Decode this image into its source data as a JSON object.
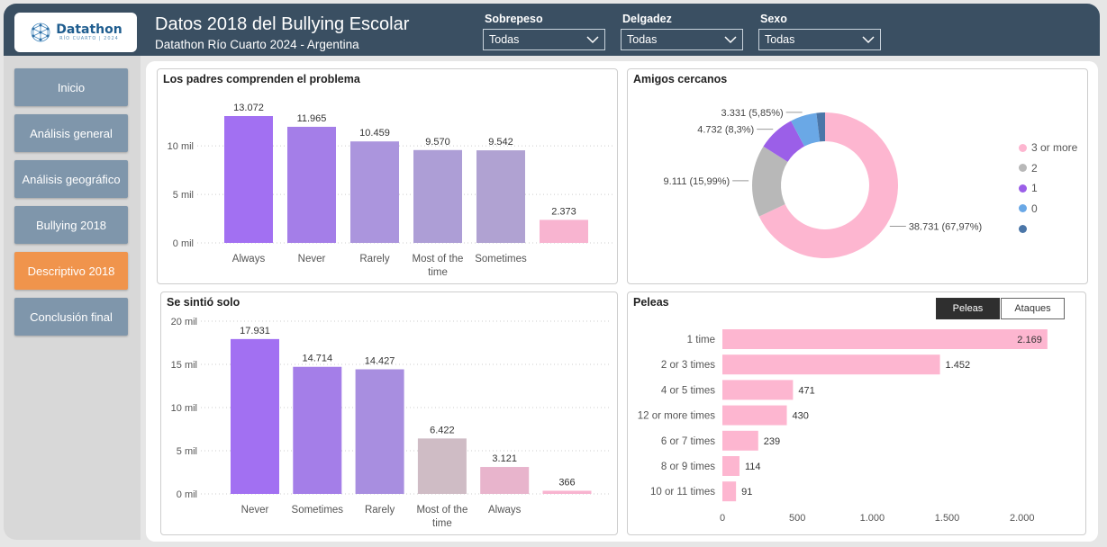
{
  "header": {
    "logo": {
      "brand": "Datathon",
      "sub": "RÍO CUARTO | 2024"
    },
    "title": "Datos 2018 del Bullying Escolar",
    "subtitle": "Datathon Río Cuarto 2024 - Argentina",
    "filters": [
      {
        "label": "Sobrepeso",
        "value": "Todas"
      },
      {
        "label": "Delgadez",
        "value": "Todas"
      },
      {
        "label": "Sexo",
        "value": "Todas"
      }
    ]
  },
  "sidebar": {
    "items": [
      {
        "label": "Inicio",
        "active": false
      },
      {
        "label": "Análisis general",
        "active": false
      },
      {
        "label": "Análisis geográfico",
        "active": false
      },
      {
        "label": "Bullying 2018",
        "active": false
      },
      {
        "label": "Descriptivo 2018",
        "active": true
      },
      {
        "label": "Conclusión final",
        "active": false
      }
    ],
    "active_color": "#f0944c",
    "default_color": "#7f96ab"
  },
  "chart_data": [
    {
      "id": "padres",
      "type": "bar",
      "title": "Los padres comprenden el problema",
      "categories": [
        "Always",
        "Never",
        "Rarely",
        "Most of the time",
        "Sometimes",
        ""
      ],
      "values": [
        13072,
        11965,
        10459,
        9570,
        9542,
        2373
      ],
      "value_labels": [
        "13.072",
        "11.965",
        "10.459",
        "9.570",
        "9.542",
        "2.373"
      ],
      "colors": [
        "#a270f2",
        "#a47ee8",
        "#ab95dd",
        "#ad9ed6",
        "#b0a2d2",
        "#f8b4d0"
      ],
      "yticks": [
        0,
        5000,
        10000
      ],
      "ytick_labels": [
        "0 mil",
        "5 mil",
        "10 mil"
      ],
      "ylim": [
        0,
        14000
      ],
      "grid": true
    },
    {
      "id": "amigos",
      "type": "pie",
      "title": "Amigos cercanos",
      "slices": [
        {
          "label": "3 or more",
          "value": 38731,
          "text": "38.731 (67,97%)",
          "color": "#fdb6d0"
        },
        {
          "label": "2",
          "value": 9111,
          "text": "9.111 (15,99%)",
          "color": "#b8b8b8"
        },
        {
          "label": "1",
          "value": 4732,
          "text": "4.732 (8,3%)",
          "color": "#9b5fe8"
        },
        {
          "label": "0",
          "value": 3331,
          "text": "3.331 (5,85%)",
          "color": "#6aa8e6"
        },
        {
          "label": "",
          "value": 1080,
          "text": "",
          "color": "#4b76a8"
        }
      ],
      "legend_position": "right"
    },
    {
      "id": "solo",
      "type": "bar",
      "title": "Se sintió solo",
      "categories": [
        "Never",
        "Sometimes",
        "Rarely",
        "Most of the time",
        "Always",
        ""
      ],
      "values": [
        17931,
        14714,
        14427,
        6422,
        3121,
        366
      ],
      "value_labels": [
        "17.931",
        "14.714",
        "14.427",
        "6.422",
        "3.121",
        "366"
      ],
      "colors": [
        "#a270f2",
        "#a47ee8",
        "#a88ee0",
        "#cfbcc5",
        "#e8b4cc",
        "#f8b4d0"
      ],
      "yticks": [
        0,
        5000,
        10000,
        15000,
        20000
      ],
      "ytick_labels": [
        "0 mil",
        "5 mil",
        "10 mil",
        "15 mil",
        "20 mil"
      ],
      "ylim": [
        0,
        20000
      ],
      "grid": true
    },
    {
      "id": "peleas",
      "type": "bar",
      "orientation": "horizontal",
      "title": "Peleas",
      "categories": [
        "1 time",
        "2 or 3 times",
        "4 or 5 times",
        "12 or more times",
        "6 or 7 times",
        "8 or 9 times",
        "10 or 11 times"
      ],
      "values": [
        2169,
        1452,
        471,
        430,
        239,
        114,
        91
      ],
      "value_labels": [
        "2.169",
        "1.452",
        "471",
        "430",
        "239",
        "114",
        "91"
      ],
      "color": "#fdb6d0",
      "xticks": [
        0,
        500,
        1000,
        1500,
        2000
      ],
      "xtick_labels": [
        "0",
        "500",
        "1.000",
        "1.500",
        "2.000"
      ],
      "xlim": [
        0,
        2200
      ]
    }
  ],
  "toggles": {
    "on": "Peleas",
    "off": "Ataques"
  }
}
